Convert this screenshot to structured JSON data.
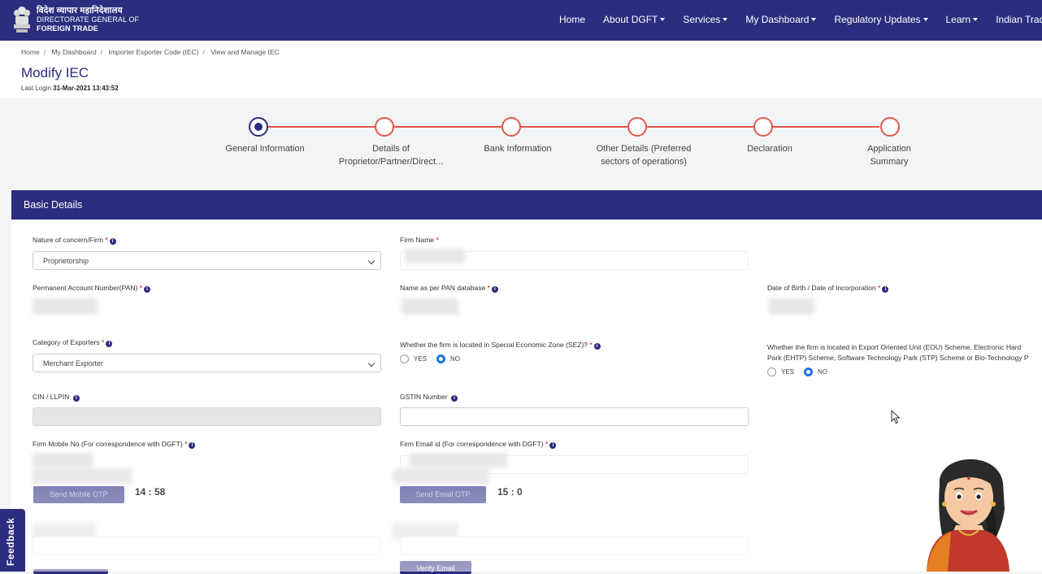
{
  "brand": {
    "line_hindi": "विदेश व्यापार महानिदेशालय",
    "line1": "DIRECTORATE GENERAL OF",
    "line2": "FOREIGN TRADE"
  },
  "nav": {
    "home": "Home",
    "about": "About DGFT",
    "services": "Services",
    "dashboard": "My Dashboard",
    "regulatory": "Regulatory Updates",
    "learn": "Learn",
    "trade_portal": "Indian Trade Servic"
  },
  "breadcrumb": {
    "home": "Home",
    "dashboard": "My Dashboard",
    "iec": "Importer Exporter Code (IEC)",
    "view": "View and Manage IEC"
  },
  "page": {
    "title": "Modify IEC",
    "last_login_label": "Last Login",
    "last_login_value": "31-Mar-2021 13:43:52"
  },
  "steps": [
    {
      "line1": "General Information",
      "line2": ""
    },
    {
      "line1": "Details of",
      "line2": "Proprietor/Partner/Direct..."
    },
    {
      "line1": "Bank Information",
      "line2": ""
    },
    {
      "line1": "Other Details (Preferred",
      "line2": "sectors of operations)"
    },
    {
      "line1": "Declaration",
      "line2": ""
    },
    {
      "line1": "Application",
      "line2": "Summary"
    }
  ],
  "section": {
    "title": "Basic Details"
  },
  "form": {
    "nature_label": "Nature of concern/Firm",
    "nature_value": "Proprietorship",
    "firm_name_label": "Firm Name",
    "pan_label": "Permanent Account Number(PAN)",
    "pan_name_label": "Name as per PAN database",
    "dob_label": "Date of Birth / Date of Incorporation",
    "category_label": "Category of Exporters",
    "category_value": "Merchant Exporter",
    "sez_label": "Whether the firm is located in Special Economic Zone (SEZ)?",
    "eou_label_line1": "Whether the firm is located in Export Oriented Unit (EOU) Scheme, Electronic Hard",
    "eou_label_line2": "Park (EHTP) Scheme, Software Technology Park (STP) Scheme or Bio-Technology P",
    "yes": "YES",
    "no": "NO",
    "required_mark": "*",
    "info_mark": "i",
    "cin_label": "CIN / LLPIN",
    "gstin_label": "GSTIN Number",
    "mobile_label": "Firm Mobile No.(For correspondence with DGFT)",
    "email_label": "Firm Email id (For correspondence with DGFT)",
    "send_mobile_otp": "Send Mobile OTP",
    "send_email_otp": "Send Email OTP",
    "mobile_timer": "14 : 58",
    "email_timer": "15 : 0",
    "verify_email": "Verify Email"
  },
  "feedback": "Feedback"
}
